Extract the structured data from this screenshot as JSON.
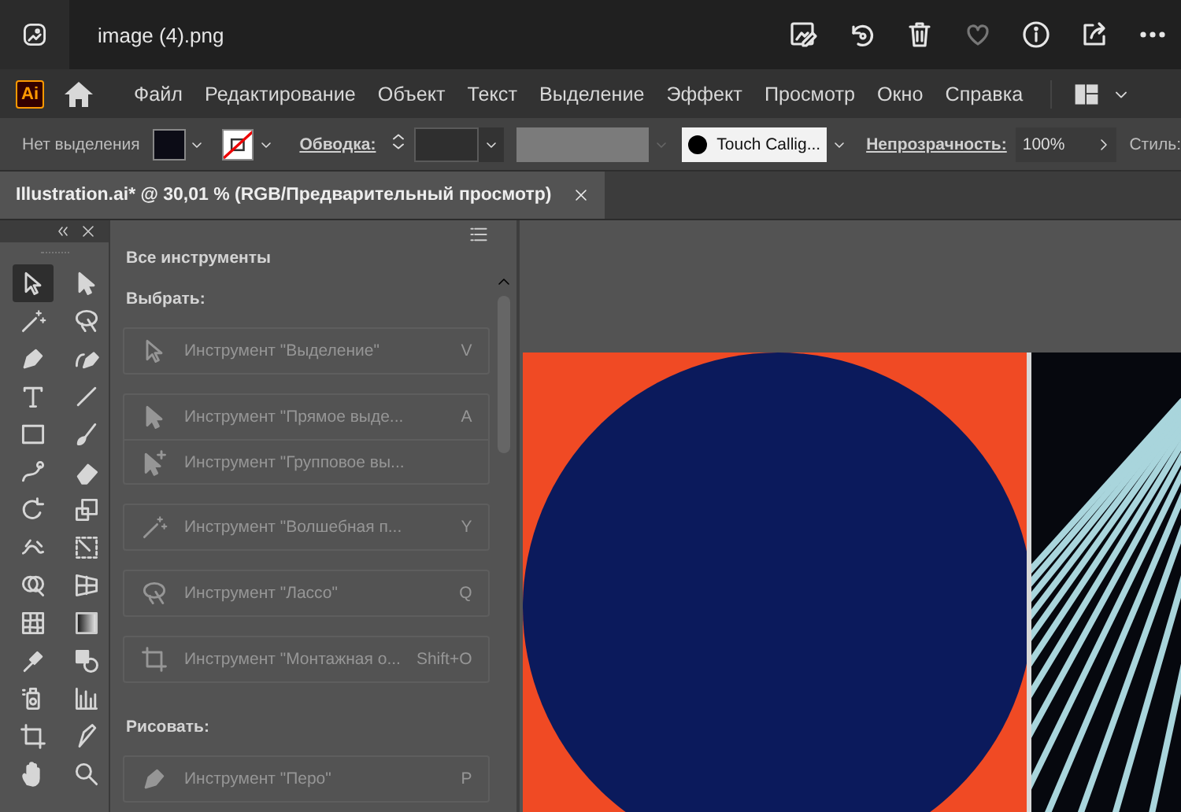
{
  "viewer": {
    "title": "image (4).png"
  },
  "app": {
    "logo": "Ai",
    "menu": [
      "Файл",
      "Редактирование",
      "Объект",
      "Текст",
      "Выделение",
      "Эффект",
      "Просмотр",
      "Окно",
      "Справка"
    ]
  },
  "control_bar": {
    "selection_label": "Нет выделения",
    "stroke_label": "Обводка:",
    "brush": "Touch Callig...",
    "opacity_label": "Непрозрачность:",
    "opacity": "100%",
    "style_label": "Стиль:"
  },
  "tabs": [
    {
      "label": "Illustration.ai* @ 30,01 % (RGB/Предварительный просмотр)",
      "selected": true
    }
  ],
  "toolbar": {
    "tools": [
      {
        "selected": true
      },
      {
        "selected": false
      },
      {
        "selected": false
      },
      {
        "selected": false
      },
      {
        "selected": false
      },
      {
        "selected": false
      },
      {
        "selected": false
      },
      {
        "selected": false
      },
      {
        "selected": false
      },
      {
        "selected": false
      },
      {
        "selected": false
      },
      {
        "selected": false
      },
      {
        "selected": false
      },
      {
        "selected": false
      },
      {
        "selected": false
      },
      {
        "selected": false
      },
      {
        "selected": false
      },
      {
        "selected": false
      },
      {
        "selected": false
      },
      {
        "selected": false
      },
      {
        "selected": false
      },
      {
        "selected": false
      },
      {
        "selected": false
      },
      {
        "selected": false
      },
      {
        "selected": false
      },
      {
        "selected": false
      },
      {
        "selected": false
      },
      {
        "selected": false
      }
    ]
  },
  "panel": {
    "title": "Все инструменты",
    "sections": [
      {
        "heading": "Выбрать:",
        "groups": [
          [
            {
              "name": "Инструмент \"Выделение\"",
              "shortcut": "V",
              "disabled": true
            }
          ],
          [
            {
              "name": "Инструмент \"Прямое выде...",
              "shortcut": "A",
              "disabled": true
            },
            {
              "name": "Инструмент \"Групповое вы...",
              "disabled": true
            }
          ],
          [
            {
              "name": "Инструмент \"Волшебная п...",
              "shortcut": "Y",
              "disabled": true
            }
          ],
          [
            {
              "name": "Инструмент \"Лассо\"",
              "shortcut": "Q",
              "disabled": true
            }
          ],
          [
            {
              "name": "Инструмент \"Монтажная о...",
              "shortcut": "Shift+O",
              "disabled": true
            }
          ]
        ]
      },
      {
        "heading": "Рисовать:",
        "groups": [
          [
            {
              "name": "Инструмент \"Перо\"",
              "shortcut": "P",
              "disabled": true
            }
          ]
        ]
      }
    ]
  }
}
